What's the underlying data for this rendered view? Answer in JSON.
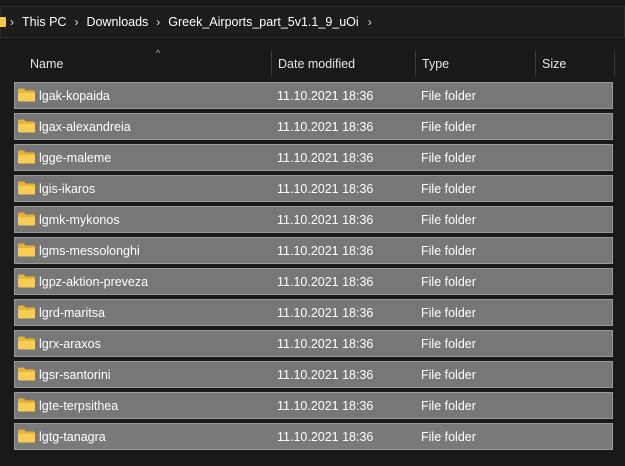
{
  "breadcrumb": {
    "items": [
      "This PC",
      "Downloads",
      "Greek_Airports_part_5v1.1_9_uOi"
    ],
    "separator": "›",
    "dropdown_chevron": "›"
  },
  "columns": {
    "sort_indicator": "^",
    "name": "Name",
    "date_modified": "Date modified",
    "type": "Type",
    "size": "Size"
  },
  "rows": [
    {
      "name": "lgak-kopaida",
      "date": "11.10.2021 18:36",
      "type": "File folder"
    },
    {
      "name": "lgax-alexandreia",
      "date": "11.10.2021 18:36",
      "type": "File folder"
    },
    {
      "name": "lgge-maleme",
      "date": "11.10.2021 18:36",
      "type": "File folder"
    },
    {
      "name": "lgis-ikaros",
      "date": "11.10.2021 18:36",
      "type": "File folder"
    },
    {
      "name": "lgmk-mykonos",
      "date": "11.10.2021 18:36",
      "type": "File folder"
    },
    {
      "name": "lgms-messolonghi",
      "date": "11.10.2021 18:36",
      "type": "File folder"
    },
    {
      "name": "lgpz-aktion-preveza",
      "date": "11.10.2021 18:36",
      "type": "File folder"
    },
    {
      "name": "lgrd-maritsa",
      "date": "11.10.2021 18:36",
      "type": "File folder"
    },
    {
      "name": "lgrx-araxos",
      "date": "11.10.2021 18:36",
      "type": "File folder"
    },
    {
      "name": "lgsr-santorini",
      "date": "11.10.2021 18:36",
      "type": "File folder"
    },
    {
      "name": "lgte-terpsithea",
      "date": "11.10.2021 18:36",
      "type": "File folder"
    },
    {
      "name": "lgtg-tanagra",
      "date": "11.10.2021 18:36",
      "type": "File folder"
    }
  ],
  "icons": {
    "folder": "folder-icon",
    "chevron": "chevron-right-icon"
  },
  "colors": {
    "background": "#191919",
    "selected_row": "#777777",
    "folder_yellow": "#f5c84c"
  }
}
